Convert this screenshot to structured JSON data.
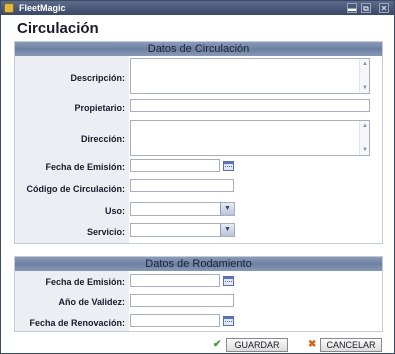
{
  "window": {
    "title": "FleetMagic",
    "controls": {
      "minimize": "▬",
      "restore": "⧉",
      "close": "✕"
    }
  },
  "page": {
    "title": "Circulación"
  },
  "circulacion": {
    "header": "Datos de Circulación",
    "descripcion": {
      "label": "Descripción:",
      "value": ""
    },
    "propietario": {
      "label": "Propietario:",
      "value": ""
    },
    "direccion": {
      "label": "Dirección:",
      "value": ""
    },
    "fecha_emision": {
      "label": "Fecha de Emisión:",
      "value": ""
    },
    "codigo": {
      "label": "Código de Circulación:",
      "value": ""
    },
    "uso": {
      "label": "Uso:",
      "value": ""
    },
    "servicio": {
      "label": "Servicio:",
      "value": ""
    }
  },
  "rodamiento": {
    "header": "Datos de Rodamiento",
    "fecha_emision": {
      "label": "Fecha de Emisión:",
      "value": ""
    },
    "anio_validez": {
      "label": "Año de Validez:",
      "value": ""
    },
    "fecha_renovacion": {
      "label": "Fecha de Renovación:",
      "value": ""
    }
  },
  "actions": {
    "save_label": "GUARDAR",
    "cancel_label": "CANCELAR",
    "save_icon": "check-icon",
    "cancel_icon": "x-icon"
  },
  "icons": {
    "textarea_up": "▲",
    "textarea_down": "▼",
    "select_arrow": "▼",
    "check": "✔",
    "cross": "✖"
  }
}
